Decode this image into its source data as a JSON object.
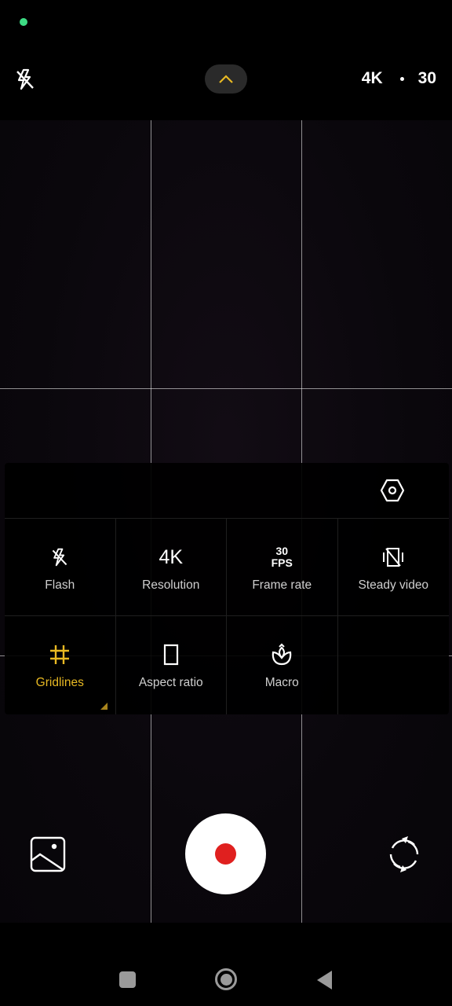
{
  "status_bar": {
    "indicator_color": "#3ddc84"
  },
  "top_bar": {
    "flash_icon": "flash-off-icon",
    "expand_icon": "chevron-up-icon",
    "resolution": "4K",
    "frame_rate": "30"
  },
  "settings_panel": {
    "settings_icon": "settings-hexagon-icon",
    "items": [
      {
        "label": "Flash",
        "icon": "flash-off-icon",
        "active": false
      },
      {
        "label": "Resolution",
        "icon_text": "4K",
        "active": false
      },
      {
        "label": "Frame rate",
        "icon_text_line1": "30",
        "icon_text_line2": "FPS",
        "active": false
      },
      {
        "label": "Steady video",
        "icon": "stabilization-off-icon",
        "active": false
      },
      {
        "label": "Gridlines",
        "icon": "grid-icon",
        "active": true
      },
      {
        "label": "Aspect ratio",
        "icon": "aspect-ratio-icon",
        "active": false
      },
      {
        "label": "Macro",
        "icon": "macro-flower-icon",
        "active": false
      }
    ]
  },
  "bottom_controls": {
    "gallery_icon": "gallery-icon",
    "shutter": "record-button",
    "flip_icon": "switch-camera-icon"
  },
  "colors": {
    "accent": "#e8b923",
    "record": "#e0201f",
    "nav": "#9a9a9a"
  }
}
